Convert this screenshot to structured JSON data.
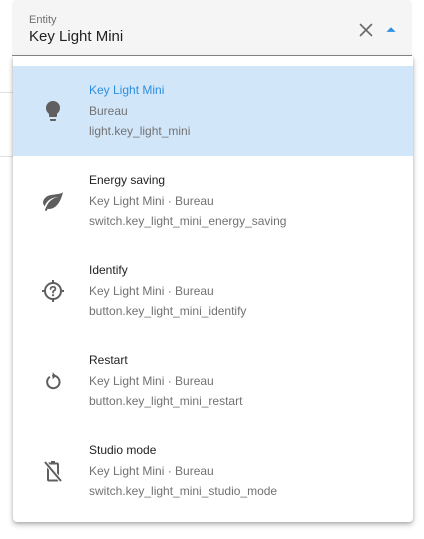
{
  "field": {
    "label": "Entity",
    "value": "Key Light Mini"
  },
  "colors": {
    "accent": "#2d8fe0",
    "selected_background": "#d2e6f9",
    "icon": "#5f5f5f"
  },
  "options": [
    {
      "title": "Key Light Mini",
      "line1": "Bureau",
      "line2": "light.key_light_mini",
      "icon": "lightbulb-icon",
      "selected": true
    },
    {
      "title": "Energy saving",
      "line1": "Key Light Mini · Bureau",
      "line2": "switch.key_light_mini_energy_saving",
      "icon": "leaf-icon",
      "selected": false
    },
    {
      "title": "Identify",
      "line1": "Key Light Mini · Bureau",
      "line2": "button.key_light_mini_identify",
      "icon": "crosshairs-question-icon",
      "selected": false
    },
    {
      "title": "Restart",
      "line1": "Key Light Mini · Bureau",
      "line2": "button.key_light_mini_restart",
      "icon": "restart-icon",
      "selected": false
    },
    {
      "title": "Studio mode",
      "line1": "Key Light Mini · Bureau",
      "line2": "switch.key_light_mini_studio_mode",
      "icon": "battery-off-icon",
      "selected": false
    }
  ]
}
